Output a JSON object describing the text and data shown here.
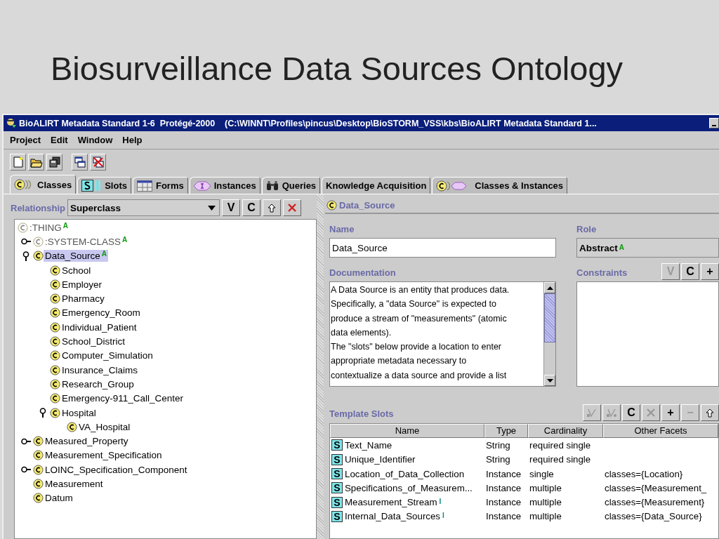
{
  "slide_title": "Biosurveillance Data Sources Ontology",
  "window": {
    "title": "BioALIRT Metadata Standard 1-6  Protégé-2000    (C:\\WINNT\\Profiles\\pincus\\Desktop\\BioSTORM_VSS\\kbs\\BioALIRT Metadata Standard 1...",
    "menu": [
      "Project",
      "Edit",
      "Window",
      "Help"
    ],
    "tabs": [
      {
        "label": "Classes",
        "kind": "classes",
        "selected": true
      },
      {
        "label": "Slots",
        "kind": "slots",
        "selected": false
      },
      {
        "label": "Forms",
        "kind": "forms",
        "selected": false
      },
      {
        "label": "Instances",
        "kind": "instances",
        "selected": false
      },
      {
        "label": "Queries",
        "kind": "queries",
        "selected": false
      },
      {
        "label": "Knowledge Acquisition",
        "kind": "plain",
        "selected": false
      },
      {
        "label": "Classes & Instances",
        "kind": "combined",
        "selected": false
      }
    ]
  },
  "class_browser": {
    "relationship_label": "Relationship",
    "relationship_value": "Superclass",
    "buttons": [
      {
        "kind": "text",
        "label": "V",
        "disabled": false
      },
      {
        "kind": "text",
        "label": "C",
        "disabled": false
      },
      {
        "kind": "up",
        "disabled": false
      },
      {
        "kind": "delete",
        "disabled": false
      }
    ],
    "tree": [
      {
        "label": ":THING",
        "disabled": true,
        "badge": "A",
        "selected": false,
        "children": [
          {
            "label": ":SYSTEM-CLASS",
            "disabled": true,
            "badge": "A",
            "selected": false,
            "expanded": false
          },
          {
            "label": "Data_Source",
            "disabled": false,
            "badge": "A",
            "selected": true,
            "expanded": true,
            "children": [
              {
                "label": "School",
                "disabled": false,
                "selected": false
              },
              {
                "label": "Employer",
                "disabled": false,
                "selected": false
              },
              {
                "label": "Pharmacy",
                "disabled": false,
                "selected": false
              },
              {
                "label": "Emergency_Room",
                "disabled": false,
                "selected": false
              },
              {
                "label": "Individual_Patient",
                "disabled": false,
                "selected": false
              },
              {
                "label": "School_District",
                "disabled": false,
                "selected": false
              },
              {
                "label": "Computer_Simulation",
                "disabled": false,
                "selected": false
              },
              {
                "label": "Insurance_Claims",
                "disabled": false,
                "selected": false
              },
              {
                "label": "Research_Group",
                "disabled": false,
                "selected": false
              },
              {
                "label": "Emergency-911_Call_Center",
                "disabled": false,
                "selected": false
              },
              {
                "label": "Hospital",
                "disabled": false,
                "selected": false,
                "expanded": true,
                "children": [
                  {
                    "label": "VA_Hospital",
                    "disabled": false,
                    "selected": false
                  }
                ]
              }
            ]
          },
          {
            "label": "Measured_Property",
            "disabled": false,
            "selected": false,
            "expanded": false
          },
          {
            "label": "Measurement_Specification",
            "disabled": false,
            "selected": false
          },
          {
            "label": "LOINC_Specification_Component",
            "disabled": false,
            "selected": false,
            "expanded": false
          },
          {
            "label": "Measurement",
            "disabled": false,
            "selected": false
          },
          {
            "label": "Datum",
            "disabled": false,
            "selected": false
          }
        ]
      }
    ]
  },
  "class_form": {
    "header": "Data_Source",
    "name_label": "Name",
    "name_value": "Data_Source",
    "role_label": "Role",
    "role_value": "Abstract",
    "role_badge": "A",
    "documentation_label": "Documentation",
    "documentation_lines": [
      "A Data Source is an entity that produces data.",
      "Specifically, a \"data Source\" is expected to",
      "produce a stream of \"measurements\" (atomic",
      "data elements).",
      "The \"slots\" below provide a location to enter",
      "appropriate metadata necessary to",
      "contextualize a data source and provide a list"
    ],
    "constraints_label": "Constraints",
    "constraint_buttons": [
      {
        "kind": "text",
        "label": "V",
        "disabled": true
      },
      {
        "kind": "text",
        "label": "C",
        "disabled": false
      },
      {
        "kind": "text",
        "label": "+",
        "disabled": false
      }
    ],
    "template_slots_label": "Template Slots",
    "slot_buttons": [
      {
        "kind": "check",
        "disabled": true
      },
      {
        "kind": "checkdot",
        "disabled": true
      },
      {
        "kind": "text",
        "label": "C",
        "disabled": false
      },
      {
        "kind": "delete",
        "disabled": true
      },
      {
        "kind": "text",
        "label": "+",
        "disabled": false
      },
      {
        "kind": "text",
        "label": "−",
        "disabled": true
      },
      {
        "kind": "up",
        "disabled": false
      }
    ],
    "columns": [
      "Name",
      "Type",
      "Cardinality",
      "Other Facets"
    ],
    "rows": [
      {
        "icon": "S",
        "name": "Text_Name",
        "type": "String",
        "cardinality": "required single"
      },
      {
        "icon": "S",
        "name": "Unique_Identifier",
        "type": "String",
        "cardinality": "required single"
      },
      {
        "icon": "S",
        "name": "Location_of_Data_Collection",
        "type": "Instance",
        "cardinality": "single",
        "facets": "classes={Location}"
      },
      {
        "icon": "S",
        "name": "Specifications_of_Measurem...",
        "type": "Instance",
        "cardinality": "multiple",
        "facets": "classes={Measurement_"
      },
      {
        "icon": "S",
        "name": "Measurement_Stream",
        "inherited_mark": "I",
        "type": "Instance",
        "cardinality": "multiple",
        "facets": "classes={Measurement}"
      },
      {
        "icon": "S",
        "name": "Internal_Data_Sources",
        "inherited_mark": "I",
        "type": "Instance",
        "cardinality": "multiple",
        "facets": "classes={Data_Source}"
      }
    ]
  }
}
